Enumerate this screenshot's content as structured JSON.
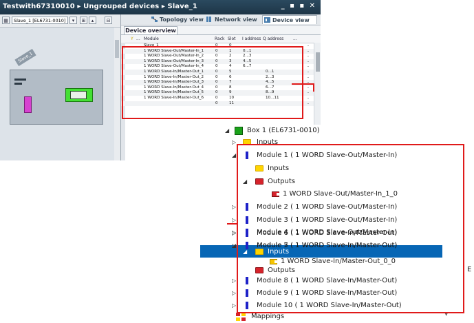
{
  "window": {
    "breadcrumb": "Testwith67310010 ▸ Ungrouped devices ▸ Slave_1",
    "controls": "_ ▪ ▪ ✕"
  },
  "left_panel": {
    "device_selector": "Slave_1 [EL6731-0010]",
    "device_label": "Slave_1"
  },
  "views": {
    "topology": "Topology view",
    "network": "Network view",
    "device": "Device view"
  },
  "overview": {
    "tab": "Device overview",
    "columns": [
      "Module",
      "Rack",
      "Slot",
      "I address",
      "Q address",
      "..."
    ],
    "rows": [
      {
        "module": "Slave_1",
        "rack": "0",
        "slot": "0",
        "i": "",
        "q": ""
      },
      {
        "module": "1 WORD Slave-Out/Master-In_1",
        "rack": "0",
        "slot": "1",
        "i": "0...1",
        "q": ""
      },
      {
        "module": "1 WORD Slave-Out/Master-In_2",
        "rack": "0",
        "slot": "2",
        "i": "2...3",
        "q": ""
      },
      {
        "module": "1 WORD Slave-Out/Master-In_3",
        "rack": "0",
        "slot": "3",
        "i": "4...5",
        "q": ""
      },
      {
        "module": "1 WORD Slave-Out/Master-In_4",
        "rack": "0",
        "slot": "4",
        "i": "6...7",
        "q": ""
      },
      {
        "module": "1 WORD Slave-In/Master-Out_1",
        "rack": "0",
        "slot": "5",
        "i": "",
        "q": "0...1"
      },
      {
        "module": "1 WORD Slave-In/Master-Out_2",
        "rack": "0",
        "slot": "6",
        "i": "",
        "q": "2...3"
      },
      {
        "module": "1 WORD Slave-In/Master-Out_3",
        "rack": "0",
        "slot": "7",
        "i": "",
        "q": "4...5"
      },
      {
        "module": "1 WORD Slave-In/Master-Out_4",
        "rack": "0",
        "slot": "8",
        "i": "",
        "q": "6...7"
      },
      {
        "module": "1 WORD Slave-In/Master-Out_5",
        "rack": "0",
        "slot": "9",
        "i": "",
        "q": "8...9"
      },
      {
        "module": "1 WORD Slave-In/Master-Out_6",
        "rack": "0",
        "slot": "10",
        "i": "",
        "q": "10...11"
      },
      {
        "module": "",
        "rack": "0",
        "slot": "11",
        "i": "",
        "q": ""
      }
    ]
  },
  "tree": {
    "box": "Box 1 (EL6731-0010)",
    "box_inputs": "Inputs",
    "m1": "Module 1 ( 1 WORD Slave-Out/Master-In)",
    "m1_inputs": "Inputs",
    "m1_outputs": "Outputs",
    "m1_var": "1 WORD Slave-Out/Master-In_1_0",
    "m2": "Module 2 ( 1 WORD Slave-Out/Master-In)",
    "m3": "Module 3 ( 1 WORD Slave-Out/Master-In)",
    "m4": "Module 4 ( 1 WORD Slave-Out/Master-In)",
    "m5": "Module 5 ( 1 WORD Slave-In/Master-Out)",
    "m6": "Module 6 ( 1 WORD Slave-In/Master-Out)",
    "m7": "Module 7 ( 1 WORD Slave-In/Master-Out)",
    "m7_inputs": "Inputs",
    "m7_var": "1 WORD Slave-In/Master-Out_0_0",
    "m7_outputs": "Outputs",
    "m8": "Module 8 ( 1 WORD Slave-In/Master-Out)",
    "m9": "Module 9 ( 1 WORD Slave-In/Master-Out)",
    "m10": "Module 10 ( 1 WORD Slave-In/Master-Out)",
    "mappings": "Mappings",
    "edge_letter": "E"
  },
  "colors": {
    "callout": "#e01a1a",
    "selection": "#0766b5",
    "module_icon": "#1e22c8",
    "inputs_folder": "#ffd500",
    "outputs_folder": "#d6232b"
  }
}
